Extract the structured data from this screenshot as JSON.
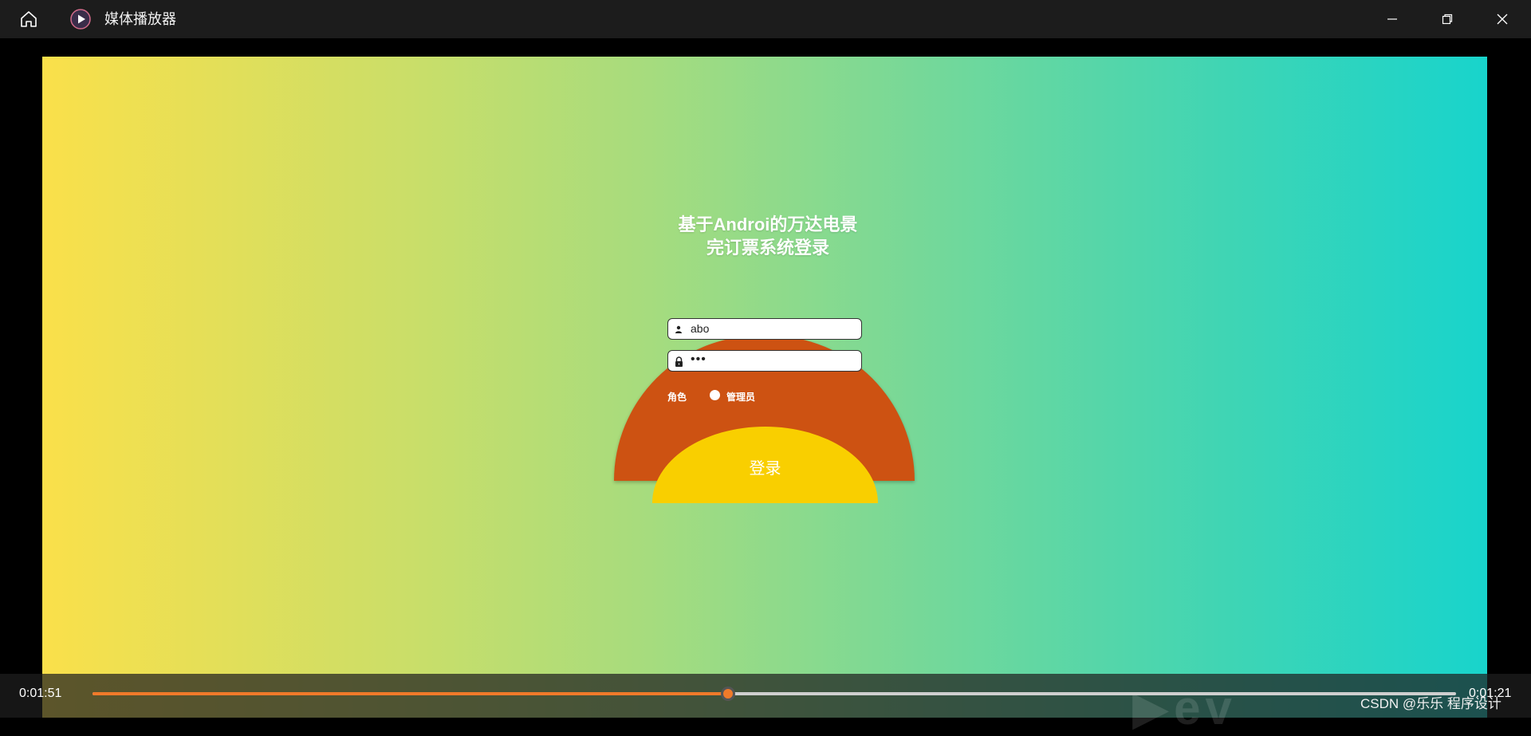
{
  "window": {
    "title": "媒体播放器",
    "icons": {
      "home": "home-icon",
      "app": "media-player-icon",
      "minimize": "minimize-icon",
      "maximize": "restore-icon",
      "close": "close-icon"
    }
  },
  "login_screen": {
    "title_line1": "基于Androi的万达电景",
    "title_line2": "完订票系统登录",
    "username_value": "abo",
    "password_value": "•••",
    "role_label": "角色",
    "role_option": "管理员",
    "login_button": "登录",
    "colors": {
      "gradient_left": "#fae04a",
      "gradient_right": "#18d4cc",
      "orange": "#cd5212",
      "yellow": "#f9cf00"
    }
  },
  "playback": {
    "current_time": "0:01:51",
    "remaining_time": "0:01:21",
    "progress": 0.466,
    "credit": "CSDN @乐乐 程序设计",
    "accent": "#f07a2a"
  }
}
